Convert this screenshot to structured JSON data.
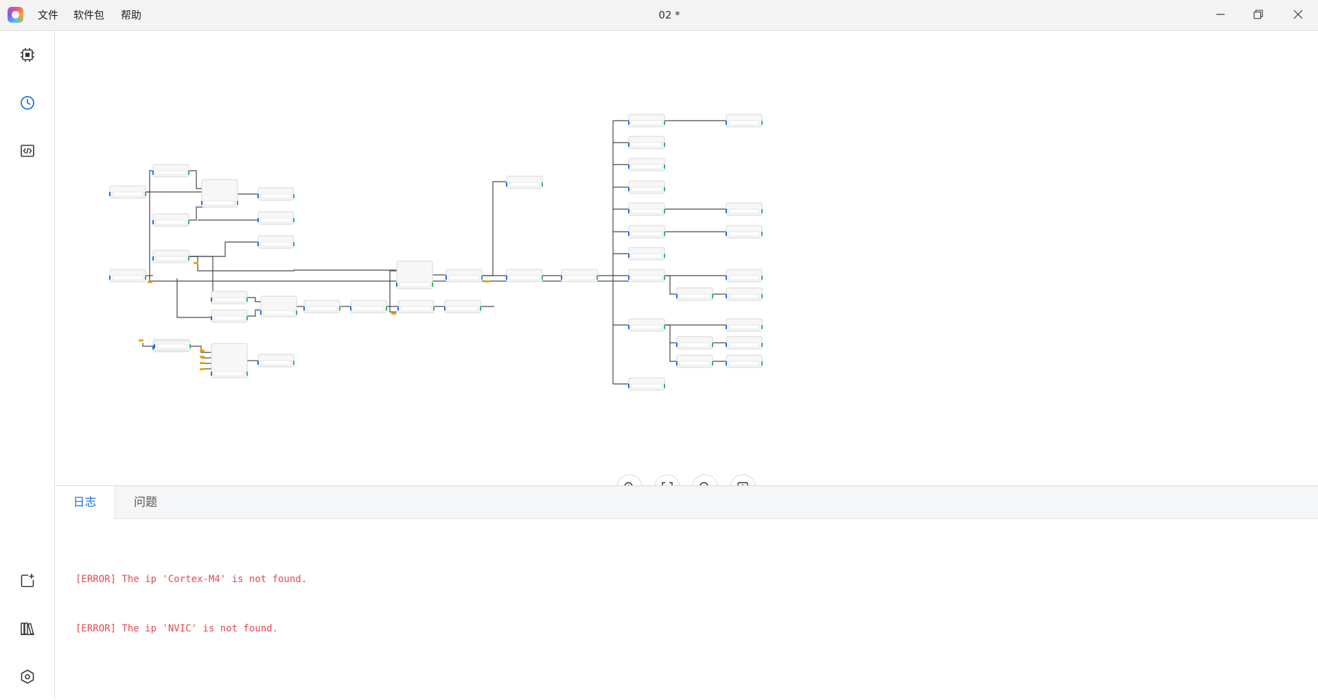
{
  "menu": {
    "items": [
      {
        "label": "文件"
      },
      {
        "label": "软件包"
      },
      {
        "label": "帮助"
      }
    ]
  },
  "window": {
    "title": "02 *"
  },
  "sidebar": {
    "top_icons": [
      "chip-icon",
      "clock-icon",
      "code-icon"
    ],
    "bottom_icons": [
      "add-project-icon",
      "library-icon",
      "settings-icon"
    ]
  },
  "canvas": {
    "controls": [
      "zoom-in-icon",
      "fit-screen-icon",
      "zoom-out-icon",
      "export-image-icon"
    ]
  },
  "panel": {
    "tabs": [
      {
        "label": "日志",
        "active": true
      },
      {
        "label": "问题",
        "active": false
      }
    ],
    "log_lines": [
      "[ERROR] The ip 'Cortex-M4' is not found.",
      "[ERROR] The ip 'NVIC' is not found."
    ]
  },
  "colors": {
    "accent": "#1a73e8",
    "error": "#e5484d",
    "node_blue_port": "#1a6fe0",
    "node_green_port": "#2bb673",
    "warning_marker": "#f0a500"
  }
}
